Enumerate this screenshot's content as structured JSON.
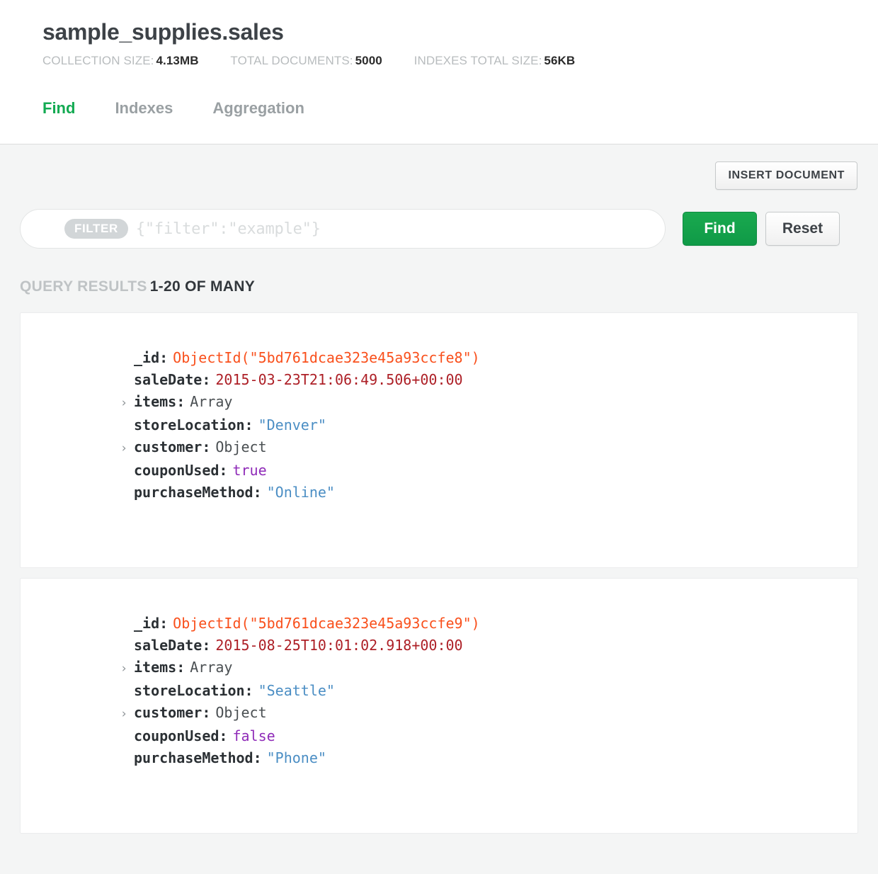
{
  "header": {
    "namespace": "sample_supplies.sales",
    "stats": [
      {
        "label": "COLLECTION SIZE:",
        "value": "4.13MB"
      },
      {
        "label": "TOTAL DOCUMENTS:",
        "value": "5000"
      },
      {
        "label": "INDEXES TOTAL SIZE:",
        "value": "56KB"
      }
    ],
    "tabs": [
      {
        "label": "Find",
        "active": true
      },
      {
        "label": "Indexes",
        "active": false
      },
      {
        "label": "Aggregation",
        "active": false
      }
    ]
  },
  "toolbar": {
    "insert_document_label": "INSERT DOCUMENT"
  },
  "query_bar": {
    "filter_badge": "FILTER",
    "filter_value": "",
    "filter_placeholder": "{\"filter\":\"example\"}",
    "find_label": "Find",
    "reset_label": "Reset"
  },
  "results": {
    "label": "QUERY RESULTS",
    "count": "1-20 OF MANY"
  },
  "documents": [
    {
      "fields": [
        {
          "expandable": false,
          "key": "_id",
          "value": "ObjectId(\"5bd761dcae323e45a93ccfe8\")",
          "type": "objectid"
        },
        {
          "expandable": false,
          "key": "saleDate",
          "value": "2015-03-23T21:06:49.506+00:00",
          "type": "date"
        },
        {
          "expandable": true,
          "key": "items",
          "value": "Array",
          "type": "type"
        },
        {
          "expandable": false,
          "key": "storeLocation",
          "value": "\"Denver\"",
          "type": "string"
        },
        {
          "expandable": true,
          "key": "customer",
          "value": "Object",
          "type": "type"
        },
        {
          "expandable": false,
          "key": "couponUsed",
          "value": "true",
          "type": "bool"
        },
        {
          "expandable": false,
          "key": "purchaseMethod",
          "value": "\"Online\"",
          "type": "string"
        }
      ]
    },
    {
      "fields": [
        {
          "expandable": false,
          "key": "_id",
          "value": "ObjectId(\"5bd761dcae323e45a93ccfe9\")",
          "type": "objectid"
        },
        {
          "expandable": false,
          "key": "saleDate",
          "value": "2015-08-25T10:01:02.918+00:00",
          "type": "date"
        },
        {
          "expandable": true,
          "key": "items",
          "value": "Array",
          "type": "type"
        },
        {
          "expandable": false,
          "key": "storeLocation",
          "value": "\"Seattle\"",
          "type": "string"
        },
        {
          "expandable": true,
          "key": "customer",
          "value": "Object",
          "type": "type"
        },
        {
          "expandable": false,
          "key": "couponUsed",
          "value": "false",
          "type": "bool"
        },
        {
          "expandable": false,
          "key": "purchaseMethod",
          "value": "\"Phone\"",
          "type": "string"
        }
      ]
    }
  ],
  "icons": {
    "expand_chevron": "chevron-right-icon"
  },
  "colors": {
    "accent_green": "#13aa52",
    "objectid": "#f9501c",
    "date": "#ad1f26",
    "string": "#4b8ec4",
    "boolean": "#8f2bb8",
    "muted": "#bfc3c5",
    "page_bg": "#f4f5f5"
  }
}
